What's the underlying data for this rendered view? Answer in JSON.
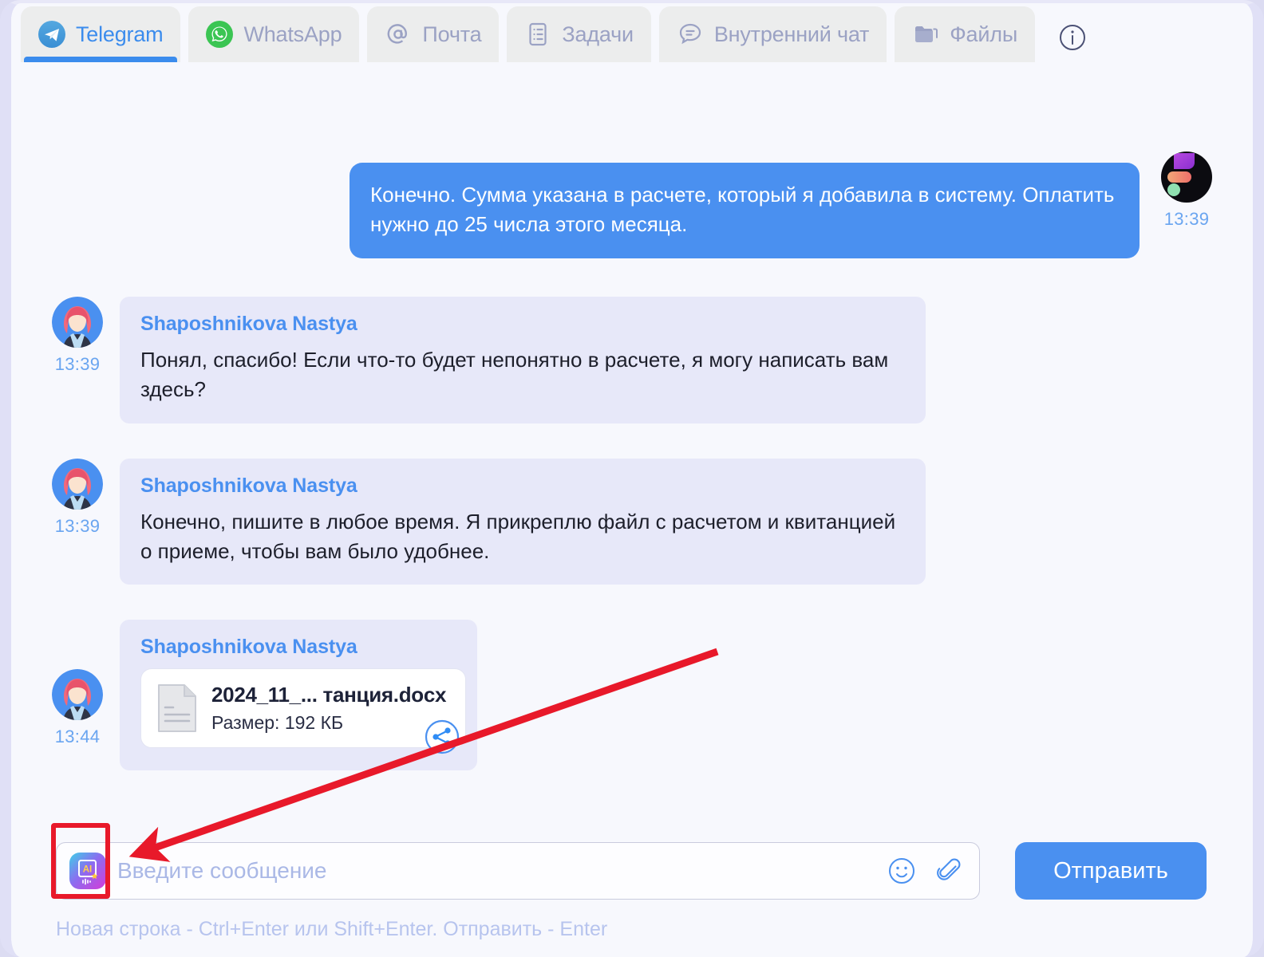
{
  "tabs": [
    {
      "label": "Telegram",
      "icon": "telegram-icon",
      "active": true
    },
    {
      "label": "WhatsApp",
      "icon": "whatsapp-icon",
      "active": false
    },
    {
      "label": "Почта",
      "icon": "mail-at-icon",
      "active": false
    },
    {
      "label": "Задачи",
      "icon": "tasks-list-icon",
      "active": false
    },
    {
      "label": "Внутренний чат",
      "icon": "internal-chat-icon",
      "active": false
    },
    {
      "label": "Файлы",
      "icon": "folder-icon",
      "active": false
    }
  ],
  "header": {
    "info_icon": "info-circle-icon"
  },
  "messages": [
    {
      "direction": "out",
      "sender": "",
      "text": "Конечно. Сумма указана в расчете, который я добавила в систему. Оплатить нужно до 25 числа этого месяца.",
      "time": "13:39",
      "avatar": "abstract-avatar"
    },
    {
      "direction": "in",
      "sender": "Shaposhnikova Nastya",
      "text": "Понял, спасибо! Если что-то будет непонятно в расчете, я могу написать вам здесь?",
      "time": "13:39",
      "avatar": "woman-avatar"
    },
    {
      "direction": "in",
      "sender": "Shaposhnikova Nastya",
      "text": "Конечно, пишите в любое время. Я прикреплю файл с расчетом и квитанцией о приеме, чтобы вам было удобнее.",
      "time": "13:39",
      "avatar": "woman-avatar"
    }
  ],
  "file_message": {
    "direction": "in",
    "sender": "Shaposhnikova Nastya",
    "time": "13:44",
    "avatar": "woman-avatar",
    "file": {
      "name": "2024_11_... танция.docx",
      "size_label": "Размер: 192 КБ",
      "doc_icon": "document-icon",
      "share_icon": "share-icon"
    }
  },
  "composer": {
    "ai_button_icon": "ai-assistant-icon",
    "input_value": "",
    "placeholder": "Введите сообщение",
    "emoji_icon": "smiley-icon",
    "attach_icon": "paperclip-icon",
    "send_label": "Отправить",
    "hint": "Новая строка - Ctrl+Enter или Shift+Enter. Отправить - Enter"
  },
  "annotation": {
    "arrow_color": "#e8192a",
    "highlight_color": "#e8192a",
    "target": "ai-assistant-icon"
  },
  "colors": {
    "accent_blue": "#4a90f0",
    "bubble_in": "#e7e8f9",
    "bubble_out": "#4a90f0",
    "page_bg": "#f7f8fd",
    "tab_bg": "#eceded",
    "tab_text_inactive": "#9ba2c4"
  }
}
